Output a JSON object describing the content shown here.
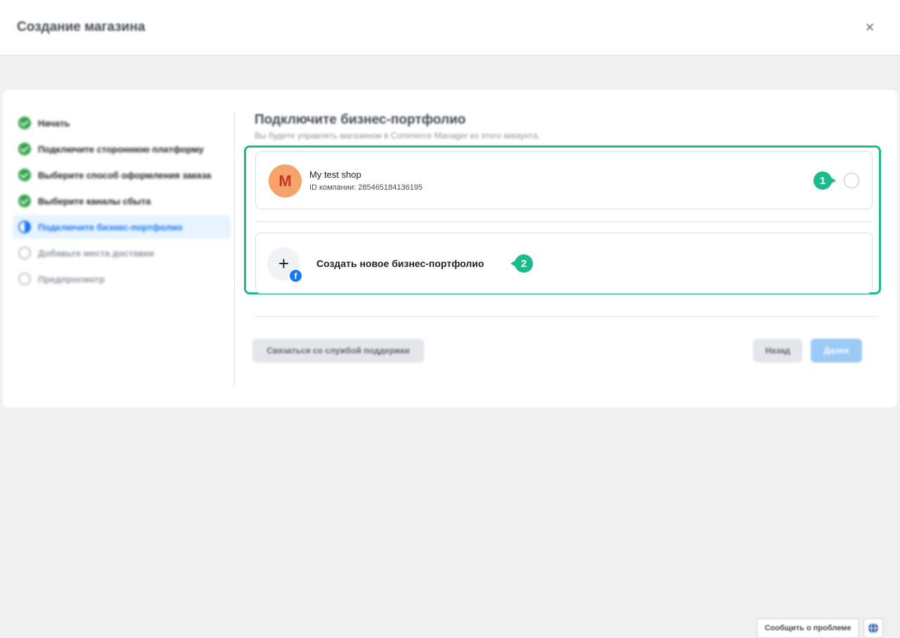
{
  "header": {
    "title": "Создание магазина",
    "close_icon": "×"
  },
  "stepper": {
    "steps": [
      {
        "label": "Начать",
        "status": "done"
      },
      {
        "label": "Подключите стороннюю платформу",
        "status": "done"
      },
      {
        "label": "Выберите способ оформления заказа",
        "status": "done"
      },
      {
        "label": "Выберите каналы сбыта",
        "status": "done"
      },
      {
        "label": "Подключите бизнес-портфолио",
        "status": "active"
      },
      {
        "label": "Добавьте места доставки",
        "status": "todo"
      },
      {
        "label": "Предпросмотр",
        "status": "todo"
      }
    ]
  },
  "main": {
    "title": "Подключите бизнес-портфолио",
    "subtitle": "Вы будете управлять магазином в Commerce Manager из этого аккаунта.",
    "account": {
      "avatar_letter": "M",
      "name": "My test shop",
      "company_id": "ID компании: 285465184136195"
    },
    "create": {
      "plus": "+",
      "fb_letter": "f",
      "label": "Создать новое бизнес-портфолио"
    },
    "annotations": {
      "one": "1",
      "two": "2"
    }
  },
  "footer": {
    "support_label": "Связаться со службой поддержки",
    "back_label": "Назад",
    "next_label": "Далее"
  },
  "bottom": {
    "report_label": "Сообщить о проблеме"
  },
  "colors": {
    "highlight": "#1bbc8b",
    "done": "#31a24c",
    "active": "#1877f2",
    "avatar": "#f5a26b"
  }
}
